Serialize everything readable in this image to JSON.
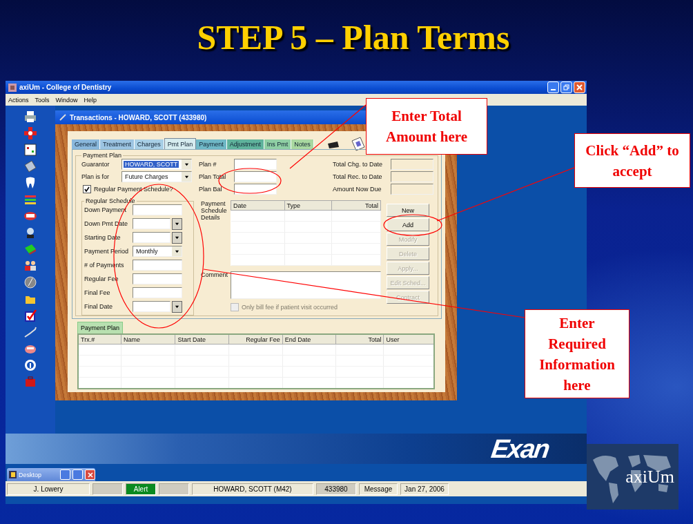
{
  "slide_title": "STEP 5 – Plan Terms",
  "app": {
    "title": "axiUm - College of Dentistry",
    "menu": [
      "Actions",
      "Tools",
      "Window",
      "Help"
    ]
  },
  "transactions": {
    "title": "Transactions - HOWARD, SCOTT (433980)",
    "tabs": [
      {
        "label": "General",
        "selected": false,
        "color": "#8ab8dc"
      },
      {
        "label": "Treatment",
        "selected": false,
        "color": "#9cc4e2"
      },
      {
        "label": "Charges",
        "selected": false,
        "color": "#a8cfe6"
      },
      {
        "label": "Pmt Plan",
        "selected": true,
        "color": "#d6ecef"
      },
      {
        "label": "Payment",
        "selected": false,
        "color": "#6fb8c6"
      },
      {
        "label": "Adjustment",
        "selected": false,
        "color": "#5fb39c"
      },
      {
        "label": "Ins Pmt",
        "selected": false,
        "color": "#8fcfa4"
      },
      {
        "label": "Notes",
        "selected": false,
        "color": "#a9d8a0"
      }
    ],
    "payment_plan": {
      "legend": "Payment Plan",
      "fields": [
        {
          "label": "Guarantor",
          "value": "HOWARD, SCOTT",
          "highlighted": true
        },
        {
          "label": "Plan is for",
          "value": "Future Charges",
          "highlighted": false
        }
      ],
      "regular_payment_schedule": {
        "label": "Regular Payment Schedule?",
        "checked": true
      }
    },
    "plan_fields": [
      {
        "label": "Plan #"
      },
      {
        "label": "Plan Total"
      },
      {
        "label": "Plan Bal"
      }
    ],
    "totals": [
      {
        "label": "Total Chg. to Date"
      },
      {
        "label": "Total Rec. to Date"
      },
      {
        "label": "Amount Now Due"
      }
    ],
    "regular_schedule": {
      "legend": "Regular Schedule",
      "fields": [
        {
          "label": "Down Payment",
          "kind": "text"
        },
        {
          "label": "Down Pmt Date",
          "kind": "date"
        },
        {
          "label": "Starting Date",
          "kind": "date"
        },
        {
          "label": "Payment Period",
          "kind": "select",
          "value": "Monthly"
        },
        {
          "label": "# of Payments",
          "kind": "text"
        },
        {
          "label": "Regular Fee",
          "kind": "text"
        },
        {
          "label": "Final Fee",
          "kind": "text"
        },
        {
          "label": "Final Date",
          "kind": "date"
        }
      ]
    },
    "schedule_details": {
      "label": "Payment Schedule Details",
      "columns": [
        "Date",
        "Type",
        "Total"
      ]
    },
    "comment": {
      "label": "Comment"
    },
    "only_bill": {
      "label": "Only bill fee if patient visit occurred",
      "checked": false,
      "disabled": true
    },
    "buttons": [
      {
        "label": "New",
        "disabled": false
      },
      {
        "label": "Add",
        "disabled": false
      },
      {
        "label": "Modify",
        "disabled": true
      },
      {
        "label": "Delete",
        "disabled": true
      },
      {
        "label": "Apply...",
        "disabled": true
      },
      {
        "label": "Edit Sched...",
        "disabled": true
      },
      {
        "label": "Contract",
        "disabled": true
      }
    ],
    "bottom_tabs": [
      {
        "label": "Payment Plan",
        "selected": true
      }
    ],
    "plans_table": {
      "columns": [
        "Trx.#",
        "Name",
        "Start Date",
        "Regular Fee",
        "End Date",
        "Total",
        "User"
      ]
    }
  },
  "brand_logo": "Exan",
  "taskbar": {
    "label": "Desktop"
  },
  "status_bar": [
    {
      "kind": "text",
      "text": "J. Lowery"
    },
    {
      "kind": "blank"
    },
    {
      "kind": "alert",
      "text": "Alert"
    },
    {
      "kind": "blank"
    },
    {
      "kind": "text",
      "text": "HOWARD, SCOTT (M42)"
    },
    {
      "kind": "shaded",
      "text": "433980"
    },
    {
      "kind": "text",
      "text": "Message"
    },
    {
      "kind": "text",
      "text": "Jan 27, 2006"
    }
  ],
  "axium_logo": "axiUm",
  "callouts": [
    {
      "text": "Enter Total Amount here"
    },
    {
      "text": "Click “Add” to accept"
    },
    {
      "text": "Enter Required Information here"
    }
  ]
}
